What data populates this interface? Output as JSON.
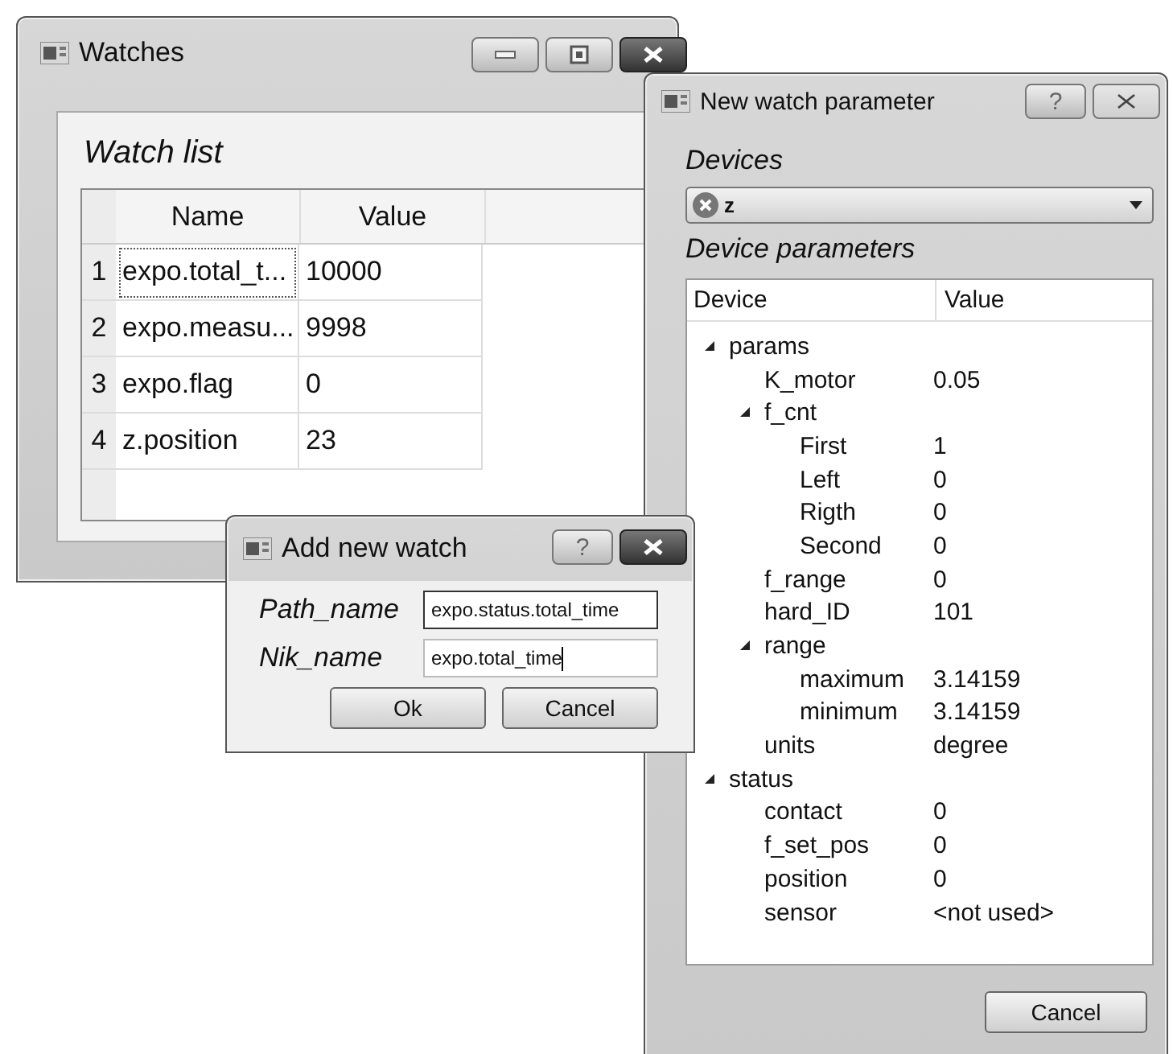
{
  "watches_window": {
    "title": "Watches",
    "group_title": "Watch list",
    "table": {
      "columns": [
        "Name",
        "Value"
      ],
      "rows": [
        {
          "index": "1",
          "name": "expo.total_t...",
          "value": "10000",
          "current": true
        },
        {
          "index": "2",
          "name": "expo.measu...",
          "value": "9998",
          "current": false
        },
        {
          "index": "3",
          "name": "expo.flag",
          "value": "0",
          "current": false
        },
        {
          "index": "4",
          "name": "z.position",
          "value": "23",
          "current": false
        }
      ]
    }
  },
  "parameter_window": {
    "title": "New watch parameter",
    "help_label": "?",
    "devices_label": "Devices",
    "device_combo": {
      "value": "z"
    },
    "parameters_label": "Device parameters",
    "tree": {
      "columns": [
        "Device",
        "Value"
      ],
      "items": [
        {
          "name": "params",
          "expanded": true,
          "children": [
            {
              "name": "K_motor",
              "value": "0.05"
            },
            {
              "name": "f_cnt",
              "expanded": true,
              "children": [
                {
                  "name": "First",
                  "value": "1"
                },
                {
                  "name": "Left",
                  "value": "0"
                },
                {
                  "name": "Rigth",
                  "value": "0"
                },
                {
                  "name": "Second",
                  "value": "0"
                }
              ]
            },
            {
              "name": "f_range",
              "value": "0"
            },
            {
              "name": "hard_ID",
              "value": "101"
            },
            {
              "name": "range",
              "expanded": true,
              "children": [
                {
                  "name": "maximum",
                  "value": "3.14159"
                },
                {
                  "name": "minimum",
                  "value": "3.14159"
                }
              ]
            },
            {
              "name": "units",
              "value": "degree"
            }
          ]
        },
        {
          "name": "status",
          "expanded": true,
          "children": [
            {
              "name": "contact",
              "value": "0"
            },
            {
              "name": "f_set_pos",
              "value": "0"
            },
            {
              "name": "position",
              "value": "0"
            },
            {
              "name": "sensor",
              "value": "<not used>"
            }
          ]
        }
      ]
    },
    "buttons": [
      "Cancel"
    ]
  },
  "add_watch_dialog": {
    "title": "Add new watch",
    "help_label": "?",
    "fields": [
      {
        "label": "Path_name",
        "value": "expo.status.total_time",
        "focused": false
      },
      {
        "label": "Nik_name",
        "value": "expo.total_time",
        "focused": true
      }
    ],
    "buttons": [
      "Ok",
      "Cancel"
    ]
  }
}
